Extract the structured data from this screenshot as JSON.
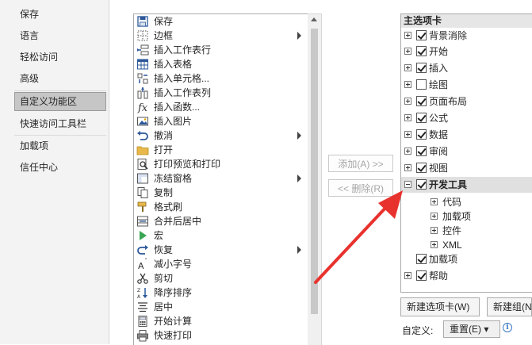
{
  "left_nav": {
    "items": [
      {
        "label": "保存"
      },
      {
        "label": "语言"
      },
      {
        "label": "轻松访问"
      },
      {
        "label": "高级"
      },
      {
        "label": "自定义功能区"
      },
      {
        "label": "快速访问工具栏"
      },
      {
        "label": "加载项"
      },
      {
        "label": "信任中心"
      }
    ],
    "selected_index": 4
  },
  "commands": [
    {
      "label": "保存",
      "icon": "save-icon",
      "submenu": false
    },
    {
      "label": "边框",
      "icon": "border-icon",
      "submenu": true
    },
    {
      "label": "插入工作表行",
      "icon": "insert-row-icon",
      "submenu": false
    },
    {
      "label": "插入表格",
      "icon": "table-icon",
      "submenu": false
    },
    {
      "label": "插入单元格...",
      "icon": "insert-cells-icon",
      "submenu": false
    },
    {
      "label": "插入工作表列",
      "icon": "insert-column-icon",
      "submenu": false
    },
    {
      "label": "插入函数...",
      "icon": "function-icon",
      "submenu": false
    },
    {
      "label": "插入图片",
      "icon": "picture-icon",
      "submenu": false
    },
    {
      "label": "撤消",
      "icon": "undo-icon",
      "submenu": true
    },
    {
      "label": "打开",
      "icon": "folder-icon",
      "submenu": false
    },
    {
      "label": "打印预览和打印",
      "icon": "print-preview-icon",
      "submenu": false
    },
    {
      "label": "冻结窗格",
      "icon": "freeze-panes-icon",
      "submenu": true
    },
    {
      "label": "复制",
      "icon": "copy-icon",
      "submenu": false
    },
    {
      "label": "格式刷",
      "icon": "format-painter-icon",
      "submenu": false
    },
    {
      "label": "合并后居中",
      "icon": "merge-center-icon",
      "submenu": false
    },
    {
      "label": "宏",
      "icon": "macro-icon",
      "submenu": false
    },
    {
      "label": "恢复",
      "icon": "redo-icon",
      "submenu": true
    },
    {
      "label": "减小字号",
      "icon": "decrease-font-icon",
      "submenu": false
    },
    {
      "label": "剪切",
      "icon": "cut-icon",
      "submenu": false
    },
    {
      "label": "降序排序",
      "icon": "sort-desc-icon",
      "submenu": false
    },
    {
      "label": "居中",
      "icon": "align-center-icon",
      "submenu": false
    },
    {
      "label": "开始计算",
      "icon": "calculate-icon",
      "submenu": false
    },
    {
      "label": "快速打印",
      "icon": "quick-print-icon",
      "submenu": false
    }
  ],
  "buttons": {
    "add": "添加(A) >>",
    "remove": "<< 删除(R)",
    "new_tab": "新建选项卡(W)",
    "new_group": "新建组(N)",
    "reset": "重置(E) ▾"
  },
  "tree": {
    "header": "主选项卡",
    "tabs": [
      {
        "label": "背景消除",
        "checked": true
      },
      {
        "label": "开始",
        "checked": true
      },
      {
        "label": "插入",
        "checked": true
      },
      {
        "label": "绘图",
        "checked": false
      },
      {
        "label": "页面布局",
        "checked": true
      },
      {
        "label": "公式",
        "checked": true
      },
      {
        "label": "数据",
        "checked": true
      },
      {
        "label": "审阅",
        "checked": true
      },
      {
        "label": "视图",
        "checked": true
      },
      {
        "label": "开发工具",
        "checked": true,
        "expanded": true
      }
    ],
    "dev_children": [
      {
        "label": "代码"
      },
      {
        "label": "加载项"
      },
      {
        "label": "控件"
      },
      {
        "label": "XML"
      }
    ],
    "tail": [
      {
        "label": "加载项",
        "checked": true,
        "has_expander": false
      },
      {
        "label": "帮助",
        "checked": true,
        "has_expander": true
      }
    ]
  },
  "customize_label": "自定义:",
  "colors": {
    "arrow": "#e8322e",
    "selected_nav": "#c6c6c6"
  }
}
